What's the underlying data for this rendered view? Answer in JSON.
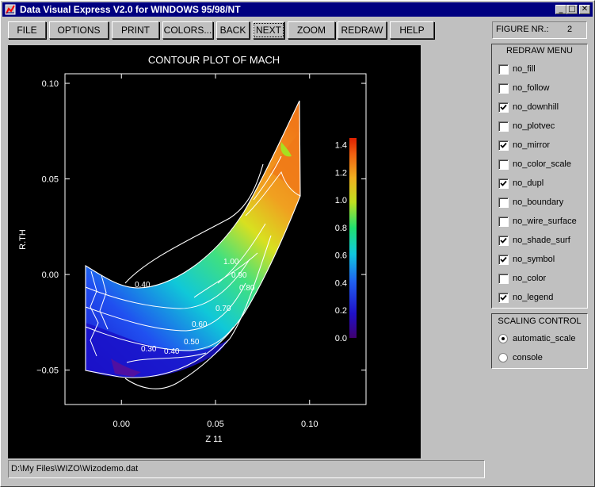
{
  "window": {
    "title": "Data Visual Express V2.0 for WINDOWS 95/98/NT",
    "min_glyph": "_",
    "max_glyph": "□",
    "close_glyph": "✕"
  },
  "toolbar": {
    "file": "FILE",
    "options": "OPTIONS",
    "print": "PRINT",
    "colors": "COLORS...",
    "back": "BACK",
    "next": "NEXT",
    "zoom": "ZOOM",
    "redraw": "REDRAW",
    "help": "HELP"
  },
  "figure": {
    "label": "FIGURE NR.:",
    "number": "2"
  },
  "redraw_menu": {
    "title": "REDRAW MENU",
    "items": [
      {
        "label": "no_fill",
        "checked": false
      },
      {
        "label": "no_follow",
        "checked": false
      },
      {
        "label": "no_downhill",
        "checked": true
      },
      {
        "label": "no_plotvec",
        "checked": false
      },
      {
        "label": "no_mirror",
        "checked": true
      },
      {
        "label": "no_color_scale",
        "checked": false
      },
      {
        "label": "no_dupl",
        "checked": true
      },
      {
        "label": "no_boundary",
        "checked": false
      },
      {
        "label": "no_wire_surface",
        "checked": false
      },
      {
        "label": "no_shade_surf",
        "checked": true
      },
      {
        "label": "no_symbol",
        "checked": true
      },
      {
        "label": "no_color",
        "checked": false
      },
      {
        "label": "no_legend",
        "checked": true
      }
    ]
  },
  "scaling_control": {
    "title": "SCALING CONTROL",
    "options": [
      {
        "label": "automatic_scale",
        "selected": true
      },
      {
        "label": "console",
        "selected": false
      }
    ]
  },
  "status": {
    "path": "D:\\My Files\\WIZO\\Wizodemo.dat"
  },
  "chart_data": {
    "type": "contour",
    "title": "CONTOUR PLOT OF MACH",
    "xlabel": "Z 11",
    "ylabel": "R.TH",
    "xlim": [
      -0.03,
      0.13
    ],
    "ylim": [
      -0.068,
      0.105
    ],
    "x_ticks": [
      "0.00",
      "0.05",
      "0.10"
    ],
    "y_ticks": [
      "0.10",
      "0.05",
      "0.00",
      "−0.05"
    ],
    "colorbar": {
      "ticks": [
        "1.4",
        "1.2",
        "1.0",
        "0.8",
        "0.6",
        "0.4",
        "0.2",
        "0.0"
      ],
      "range": [
        0.0,
        1.45
      ]
    },
    "contour_labels": [
      "1.00",
      "0.90",
      "0.80",
      "0.70",
      "0.60",
      "0.50",
      "0.40",
      "0.30",
      "0.40"
    ],
    "colors": {
      "background": "#000000",
      "lines": "#ffffff",
      "low": "#1010c8",
      "mid": "#20c890",
      "high": "#f07818"
    }
  }
}
